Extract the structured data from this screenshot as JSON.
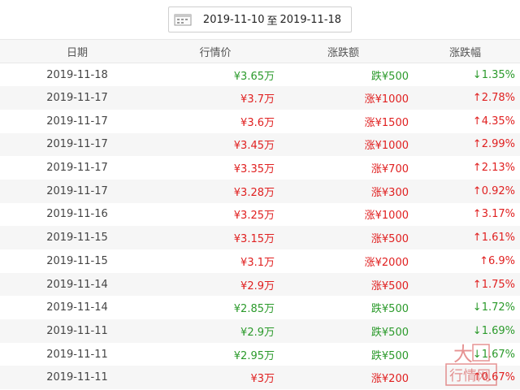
{
  "date_range": {
    "start": "2019-11-10",
    "separator": "至",
    "end": "2019-11-18"
  },
  "table": {
    "headers": {
      "date": "日期",
      "price": "行情价",
      "change": "涨跌额",
      "pct": "涨跌幅"
    },
    "rows": [
      {
        "date": "2019-11-18",
        "price": "¥3.65万",
        "change": "跌¥500",
        "pct": "↓1.35%",
        "dir": "down"
      },
      {
        "date": "2019-11-17",
        "price": "¥3.7万",
        "change": "涨¥1000",
        "pct": "↑2.78%",
        "dir": "up"
      },
      {
        "date": "2019-11-17",
        "price": "¥3.6万",
        "change": "涨¥1500",
        "pct": "↑4.35%",
        "dir": "up"
      },
      {
        "date": "2019-11-17",
        "price": "¥3.45万",
        "change": "涨¥1000",
        "pct": "↑2.99%",
        "dir": "up"
      },
      {
        "date": "2019-11-17",
        "price": "¥3.35万",
        "change": "涨¥700",
        "pct": "↑2.13%",
        "dir": "up"
      },
      {
        "date": "2019-11-17",
        "price": "¥3.28万",
        "change": "涨¥300",
        "pct": "↑0.92%",
        "dir": "up"
      },
      {
        "date": "2019-11-16",
        "price": "¥3.25万",
        "change": "涨¥1000",
        "pct": "↑3.17%",
        "dir": "up"
      },
      {
        "date": "2019-11-15",
        "price": "¥3.15万",
        "change": "涨¥500",
        "pct": "↑1.61%",
        "dir": "up"
      },
      {
        "date": "2019-11-15",
        "price": "¥3.1万",
        "change": "涨¥2000",
        "pct": "↑6.9%",
        "dir": "up"
      },
      {
        "date": "2019-11-14",
        "price": "¥2.9万",
        "change": "涨¥500",
        "pct": "↑1.75%",
        "dir": "up"
      },
      {
        "date": "2019-11-14",
        "price": "¥2.85万",
        "change": "跌¥500",
        "pct": "↓1.72%",
        "dir": "down"
      },
      {
        "date": "2019-11-11",
        "price": "¥2.9万",
        "change": "跌¥500",
        "pct": "↓1.69%",
        "dir": "down"
      },
      {
        "date": "2019-11-11",
        "price": "¥2.95万",
        "change": "跌¥500",
        "pct": "↓1.67%",
        "dir": "down"
      },
      {
        "date": "2019-11-11",
        "price": "¥3万",
        "change": "涨¥200",
        "pct": "↑0.67%",
        "dir": "up"
      }
    ]
  },
  "colors": {
    "up": "#e02020",
    "down": "#2b9a2b",
    "watermark": "#d23a3a"
  },
  "watermark": {
    "line1": "大",
    "line2": "行情网"
  },
  "icons": {
    "calendar": "calendar-icon"
  }
}
